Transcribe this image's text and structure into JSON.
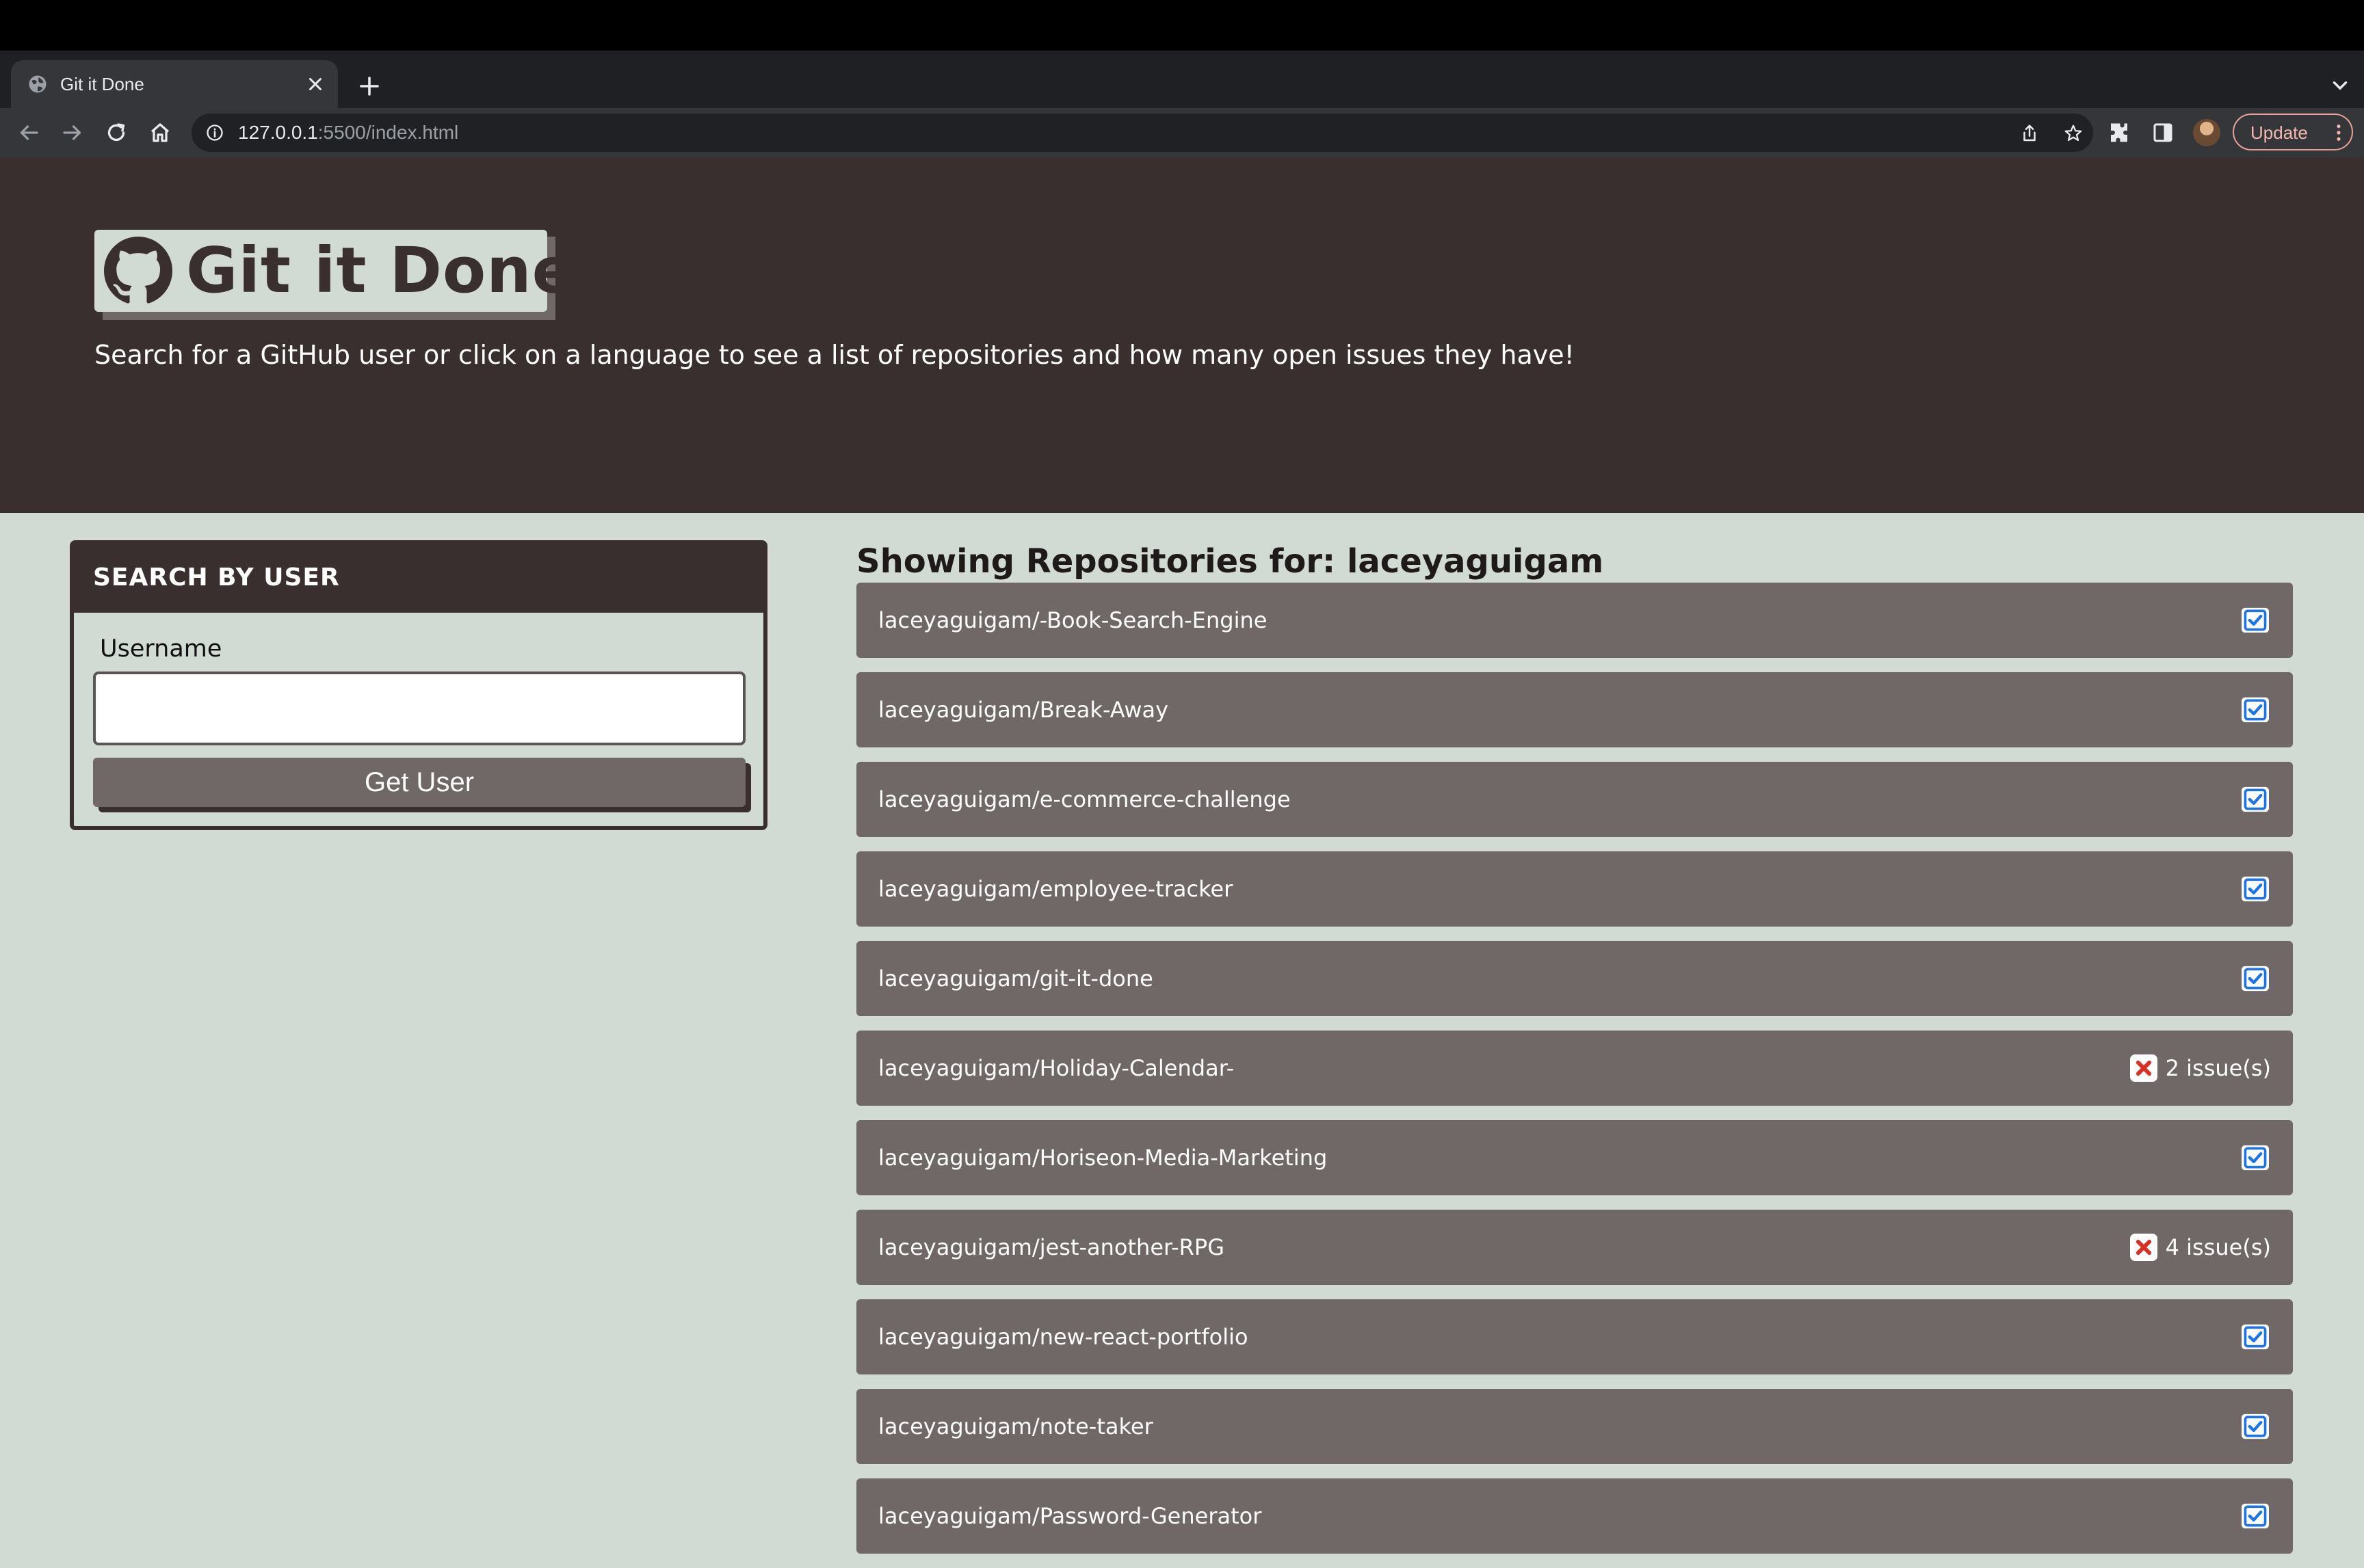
{
  "browser": {
    "tab_title": "Git it Done",
    "url_host": "127.0.0.1",
    "url_path": ":5500/index.html",
    "update_label": "Update"
  },
  "header": {
    "title": "Git it Done!",
    "subtitle": "Search for a GitHub user or click on a language to see a list of repositories and how many open issues they have!"
  },
  "search": {
    "card_title": "SEARCH BY USER",
    "username_label": "Username",
    "username_value": "",
    "button_label": "Get User"
  },
  "repos": {
    "heading": "Showing Repositories for: laceyaguigam",
    "items": [
      {
        "name": "laceyaguigam/-Book-Search-Engine",
        "status": "ok",
        "issues": ""
      },
      {
        "name": "laceyaguigam/Break-Away",
        "status": "ok",
        "issues": ""
      },
      {
        "name": "laceyaguigam/e-commerce-challenge",
        "status": "ok",
        "issues": ""
      },
      {
        "name": "laceyaguigam/employee-tracker",
        "status": "ok",
        "issues": ""
      },
      {
        "name": "laceyaguigam/git-it-done",
        "status": "ok",
        "issues": ""
      },
      {
        "name": "laceyaguigam/Holiday-Calendar-",
        "status": "issues",
        "issues": "2 issue(s)"
      },
      {
        "name": "laceyaguigam/Horiseon-Media-Marketing",
        "status": "ok",
        "issues": ""
      },
      {
        "name": "laceyaguigam/jest-another-RPG",
        "status": "issues",
        "issues": "4 issue(s)"
      },
      {
        "name": "laceyaguigam/new-react-portfolio",
        "status": "ok",
        "issues": ""
      },
      {
        "name": "laceyaguigam/note-taker",
        "status": "ok",
        "issues": ""
      },
      {
        "name": "laceyaguigam/Password-Generator",
        "status": "ok",
        "issues": ""
      }
    ]
  },
  "colors": {
    "header_bg": "#3a2f2f",
    "page_bg": "#d1dad3",
    "repo_item_bg": "#6f6866",
    "check_blue": "#1a73e8",
    "error_red": "#d93025"
  }
}
